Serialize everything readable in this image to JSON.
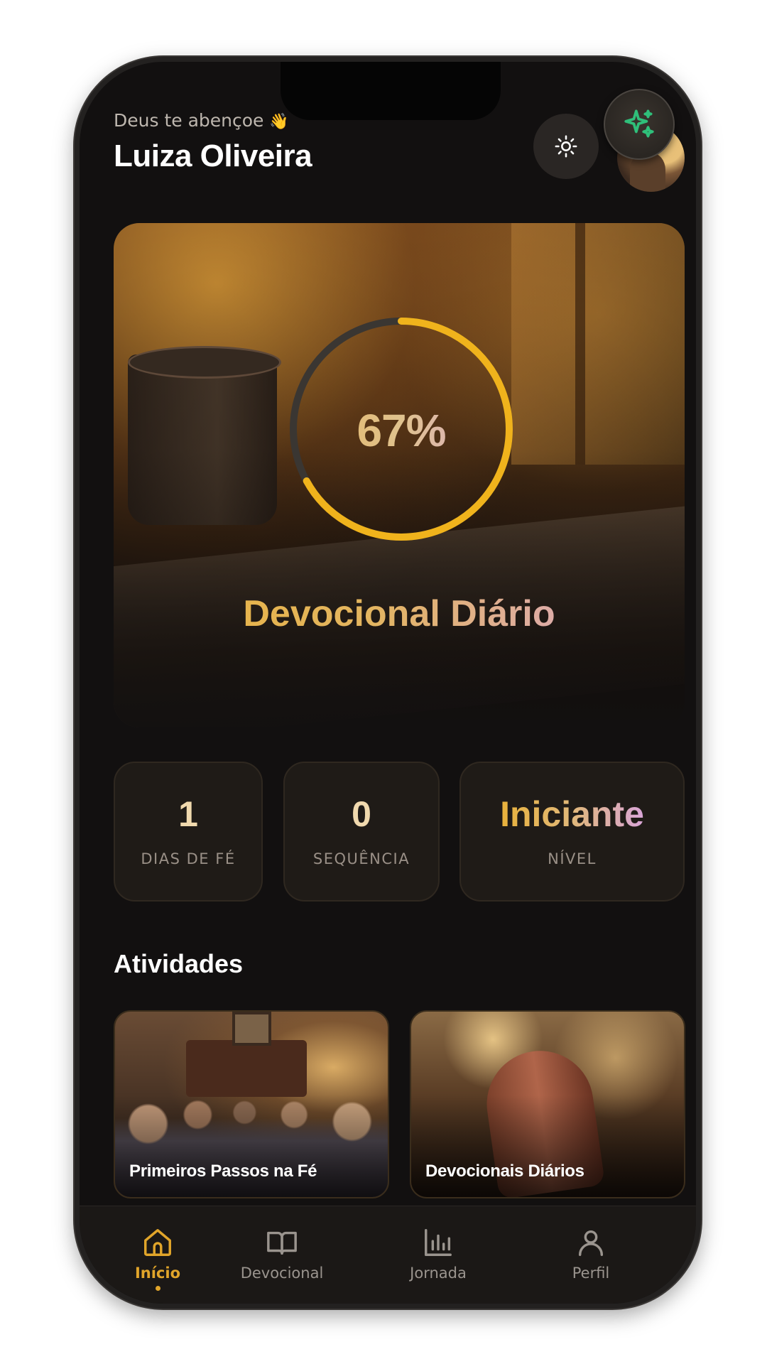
{
  "header": {
    "greeting": "Deus te abençoe",
    "greeting_emoji": "👋",
    "user_name": "Luiza Oliveira"
  },
  "hero": {
    "progress_label": "67%",
    "progress_fraction": 0.67,
    "title": "Devocional Diário"
  },
  "stats": [
    {
      "value": "1",
      "label": "DIAS DE FÉ"
    },
    {
      "value": "0",
      "label": "SEQUÊNCIA"
    },
    {
      "value": "Iniciante",
      "label": "NÍVEL"
    }
  ],
  "activities": {
    "section_title": "Atividades",
    "items": [
      {
        "title": "Primeiros Passos na Fé"
      },
      {
        "title": "Devocionais Diários"
      }
    ]
  },
  "tabbar": {
    "items": [
      {
        "label": "Início",
        "icon": "home-icon",
        "active": true
      },
      {
        "label": "Devocional",
        "icon": "book-icon",
        "active": false
      },
      {
        "label": "Jornada",
        "icon": "bar-chart-icon",
        "active": false
      },
      {
        "label": "Perfil",
        "icon": "user-icon",
        "active": false
      }
    ]
  },
  "colors": {
    "accent": "#e1a52a",
    "ring_track": "#3a3632",
    "ring_fill": "#f0b31c",
    "ai_sparkle": "#2fbf7a",
    "background": "#121010"
  }
}
